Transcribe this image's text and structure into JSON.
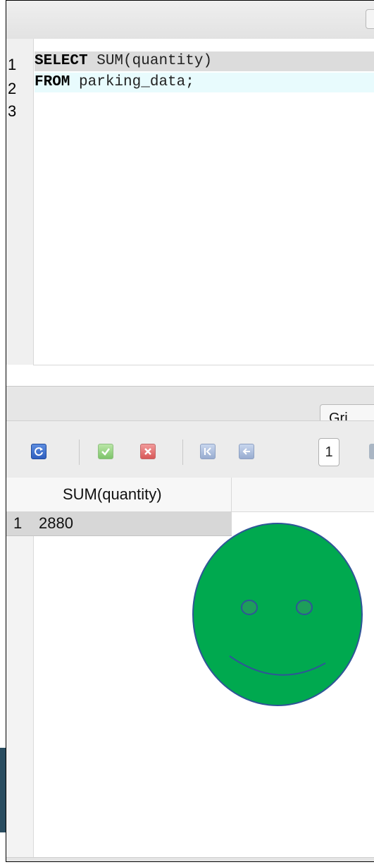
{
  "editor": {
    "lines": [
      {
        "number": "1",
        "keyword": "SELECT",
        "rest": " SUM(quantity)"
      },
      {
        "number": "2",
        "keyword": "FROM",
        "rest": " parking_data;"
      },
      {
        "number": "3",
        "keyword": "",
        "rest": ""
      }
    ]
  },
  "results": {
    "tab_label": "Gri",
    "page_number": "1",
    "toolbar_icons": [
      "refresh-icon",
      "commit-icon",
      "rollback-icon",
      "first-page-icon",
      "previous-page-icon",
      "next-page-icon"
    ],
    "columns": [
      "SUM(quantity)"
    ],
    "rows": [
      {
        "number": "1",
        "value": "2880"
      }
    ]
  },
  "colors": {
    "smiley_fill": "#00a94f",
    "smiley_stroke": "#2f5597",
    "line1_highlight": "#dcdcdc",
    "line2_highlight": "#e8fbfd",
    "side_strip": "#2a4d60"
  }
}
